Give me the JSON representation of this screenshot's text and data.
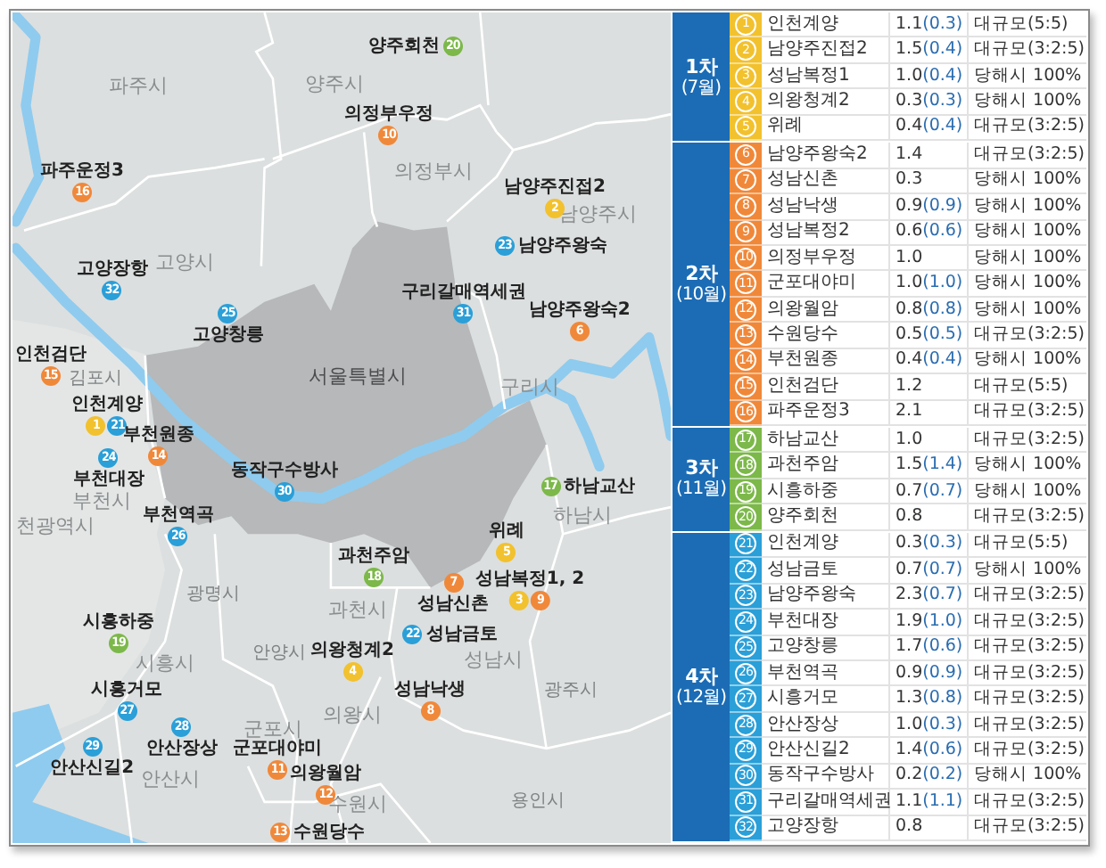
{
  "map": {
    "districts": [
      "파주시",
      "양주시",
      "의정부시",
      "남양주시",
      "고양시",
      "김포시",
      "서울특별시",
      "구리시",
      "부천시",
      "천광역시",
      "하남시",
      "광명시",
      "과천시",
      "안양시",
      "시흥시",
      "성남시",
      "광주시",
      "의왕시",
      "군포시",
      "안산시",
      "수원시",
      "용인시"
    ],
    "sites": [
      {
        "label": "양주회천",
        "numbers": [
          {
            "number": "20",
            "color": "#7cb84a"
          }
        ]
      },
      {
        "label": "의정부우정",
        "numbers": [
          {
            "number": "10",
            "color": "#f0883a"
          }
        ]
      },
      {
        "label": "파주운정3",
        "numbers": [
          {
            "number": "16",
            "color": "#f0883a"
          }
        ]
      },
      {
        "label": "남양주진접2",
        "numbers": [
          {
            "number": "2",
            "color": "#f2c12e"
          }
        ]
      },
      {
        "label": "남양주왕숙",
        "numbers": [
          {
            "number": "23",
            "color": "#2a9fd8"
          }
        ]
      },
      {
        "label": "고양장항",
        "numbers": [
          {
            "number": "32",
            "color": "#2a9fd8"
          }
        ]
      },
      {
        "label": "구리갈매역세권",
        "numbers": [
          {
            "number": "31",
            "color": "#2a9fd8"
          }
        ]
      },
      {
        "label": "남양주왕숙2",
        "numbers": [
          {
            "number": "6",
            "color": "#f0883a"
          }
        ]
      },
      {
        "label": "고양창릉",
        "numbers": [
          {
            "number": "25",
            "color": "#2a9fd8"
          }
        ]
      },
      {
        "label": "인천검단",
        "numbers": [
          {
            "number": "15",
            "color": "#f0883a"
          }
        ]
      },
      {
        "label": "인천계양",
        "numbers": [
          {
            "number": "1",
            "color": "#f2c12e"
          },
          {
            "number": "21",
            "color": "#2a9fd8"
          }
        ]
      },
      {
        "label": "부천원종",
        "numbers": [
          {
            "number": "14",
            "color": "#f0883a"
          }
        ]
      },
      {
        "label": "부천대장",
        "numbers": [
          {
            "number": "24",
            "color": "#2a9fd8"
          }
        ]
      },
      {
        "label": "동작구수방사",
        "numbers": [
          {
            "number": "30",
            "color": "#2a9fd8"
          }
        ]
      },
      {
        "label": "하남교산",
        "numbers": [
          {
            "number": "17",
            "color": "#7cb84a"
          }
        ]
      },
      {
        "label": "부천역곡",
        "numbers": [
          {
            "number": "26",
            "color": "#2a9fd8"
          }
        ]
      },
      {
        "label": "위례",
        "numbers": [
          {
            "number": "5",
            "color": "#f2c12e"
          }
        ]
      },
      {
        "label": "과천주암",
        "numbers": [
          {
            "number": "18",
            "color": "#7cb84a"
          }
        ]
      },
      {
        "label": "성남신촌",
        "numbers": [
          {
            "number": "7",
            "color": "#f0883a"
          }
        ]
      },
      {
        "label": "성남복정1, 2",
        "numbers": [
          {
            "number": "3",
            "color": "#f2c12e"
          },
          {
            "number": "9",
            "color": "#f0883a"
          }
        ]
      },
      {
        "label": "시흥하중",
        "numbers": [
          {
            "number": "19",
            "color": "#7cb84a"
          }
        ]
      },
      {
        "label": "성남금토",
        "numbers": [
          {
            "number": "22",
            "color": "#2a9fd8"
          }
        ]
      },
      {
        "label": "의왕청계2",
        "numbers": [
          {
            "number": "4",
            "color": "#f2c12e"
          }
        ]
      },
      {
        "label": "시흥거모",
        "numbers": [
          {
            "number": "27",
            "color": "#2a9fd8"
          }
        ]
      },
      {
        "label": "성남낙생",
        "numbers": [
          {
            "number": "8",
            "color": "#f0883a"
          }
        ]
      },
      {
        "label": "안산장상",
        "numbers": [
          {
            "number": "28",
            "color": "#2a9fd8"
          }
        ]
      },
      {
        "label": "안산신길2",
        "numbers": [
          {
            "number": "29",
            "color": "#2a9fd8"
          }
        ]
      },
      {
        "label": "군포대야미",
        "numbers": [
          {
            "number": "11",
            "color": "#f0883a"
          }
        ]
      },
      {
        "label": "의왕월암",
        "numbers": [
          {
            "number": "12",
            "color": "#f0883a"
          }
        ]
      },
      {
        "label": "수원당수",
        "numbers": [
          {
            "number": "13",
            "color": "#f0883a"
          }
        ]
      }
    ]
  },
  "table": {
    "groups": [
      {
        "label": "1차",
        "period": "(7월)",
        "color": "#f2c12e",
        "rows": [
          {
            "number": "1",
            "name": "인천계양",
            "area": "1.1",
            "sub": "(0.3)",
            "type": "대규모(5:5)"
          },
          {
            "number": "2",
            "name": "남양주진접2",
            "area": "1.5",
            "sub": "(0.4)",
            "type": "대규모(3:2:5)"
          },
          {
            "number": "3",
            "name": "성남복정1",
            "area": "1.0",
            "sub": "(0.4)",
            "type": "당해시 100%"
          },
          {
            "number": "4",
            "name": "의왕청계2",
            "area": "0.3",
            "sub": "(0.3)",
            "type": "당해시 100%"
          },
          {
            "number": "5",
            "name": "위례",
            "area": "0.4",
            "sub": "(0.4)",
            "type": "대규모(3:2:5)"
          }
        ]
      },
      {
        "label": "2차",
        "period": "(10월)",
        "color": "#f0883a",
        "rows": [
          {
            "number": "6",
            "name": "남양주왕숙2",
            "area": "1.4",
            "type": "대규모(3:2:5)"
          },
          {
            "number": "7",
            "name": "성남신촌",
            "area": "0.3",
            "type": "당해시 100%"
          },
          {
            "number": "8",
            "name": "성남낙생",
            "area": "0.9",
            "sub": "(0.9)",
            "type": "당해시 100%"
          },
          {
            "number": "9",
            "name": "성남복정2",
            "area": "0.6",
            "sub": "(0.6)",
            "type": "당해시 100%"
          },
          {
            "number": "10",
            "name": "의정부우정",
            "area": "1.0",
            "type": "당해시 100%"
          },
          {
            "number": "11",
            "name": "군포대야미",
            "area": "1.0",
            "sub": "(1.0)",
            "type": "당해시 100%"
          },
          {
            "number": "12",
            "name": "의왕월암",
            "area": "0.8",
            "sub": "(0.8)",
            "type": "당해시 100%"
          },
          {
            "number": "13",
            "name": "수원당수",
            "area": "0.5",
            "sub": "(0.5)",
            "type": "대규모(3:2:5)"
          },
          {
            "number": "14",
            "name": "부천원종",
            "area": "0.4",
            "sub": "(0.4)",
            "type": "당해시 100%"
          },
          {
            "number": "15",
            "name": "인천검단",
            "area": "1.2",
            "type": "대규모(5:5)"
          },
          {
            "number": "16",
            "name": "파주운정3",
            "area": "2.1",
            "type": "대규모(3:2:5)"
          }
        ]
      },
      {
        "label": "3차",
        "period": "(11월)",
        "color": "#7cb84a",
        "rows": [
          {
            "number": "17",
            "name": "하남교산",
            "area": "1.0",
            "type": "대규모(3:2:5)"
          },
          {
            "number": "18",
            "name": "과천주암",
            "area": "1.5",
            "sub": "(1.4)",
            "type": "당해시 100%"
          },
          {
            "number": "19",
            "name": "시흥하중",
            "area": "0.7",
            "sub": "(0.7)",
            "type": "당해시 100%"
          },
          {
            "number": "20",
            "name": "양주회천",
            "area": "0.8",
            "type": "대규모(3:2:5)"
          }
        ]
      },
      {
        "label": "4차",
        "period": "(12월)",
        "color": "#2a9fd8",
        "rows": [
          {
            "number": "21",
            "name": "인천계양",
            "area": "0.3",
            "sub": "(0.3)",
            "type": "대규모(5:5)"
          },
          {
            "number": "22",
            "name": "성남금토",
            "area": "0.7",
            "sub": "(0.7)",
            "type": "당해시 100%"
          },
          {
            "number": "23",
            "name": "남양주왕숙",
            "area": "2.3",
            "sub": "(0.7)",
            "type": "대규모(3:2:5)"
          },
          {
            "number": "24",
            "name": "부천대장",
            "area": "1.9",
            "sub": "(1.0)",
            "type": "대규모(3:2:5)"
          },
          {
            "number": "25",
            "name": "고양창릉",
            "area": "1.7",
            "sub": "(0.6)",
            "type": "대규모(3:2:5)"
          },
          {
            "number": "26",
            "name": "부천역곡",
            "area": "0.9",
            "sub": "(0.9)",
            "type": "대규모(3:2:5)"
          },
          {
            "number": "27",
            "name": "시흥거모",
            "area": "1.3",
            "sub": "(0.8)",
            "type": "대규모(3:2:5)"
          },
          {
            "number": "28",
            "name": "안산장상",
            "area": "1.0",
            "sub": "(0.3)",
            "type": "대규모(3:2:5)"
          },
          {
            "number": "29",
            "name": "안산신길2",
            "area": "1.4",
            "sub": "(0.6)",
            "type": "대규모(3:2:5)"
          },
          {
            "number": "30",
            "name": "동작구수방사",
            "area": "0.2",
            "sub": "(0.2)",
            "type": "당해시 100%"
          },
          {
            "number": "31",
            "name": "구리갈매역세권",
            "area": "1.1",
            "sub": "(1.1)",
            "type": "대규모(3:2:5)"
          },
          {
            "number": "32",
            "name": "고양장항",
            "area": "0.8",
            "type": "대규모(3:2:5)"
          }
        ]
      }
    ]
  }
}
